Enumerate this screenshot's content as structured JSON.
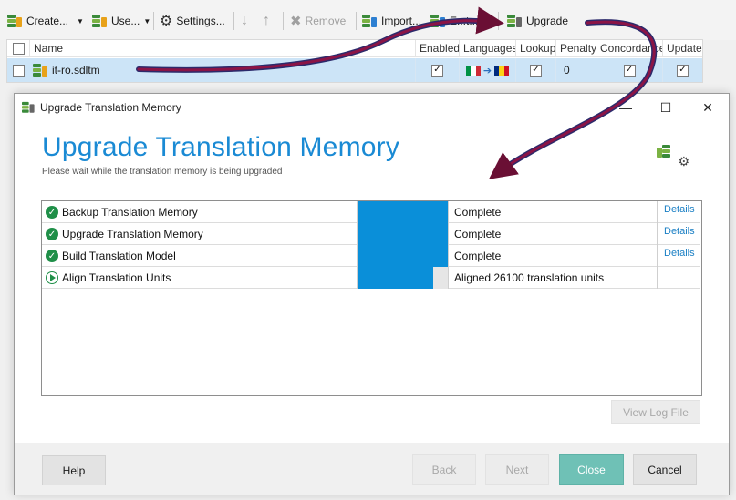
{
  "toolbar": {
    "create_label": "Create...",
    "use_label": "Use...",
    "settings_label": "Settings...",
    "remove_label": "Remove",
    "import_label": "Import...",
    "export_label": "E...t...",
    "upgrade_label": "Upgrade"
  },
  "grid": {
    "columns": [
      "Name",
      "Enabled",
      "Languages",
      "Lookup",
      "Penalty",
      "Concordance",
      "Update"
    ],
    "row": {
      "name": "it-ro.sdltm",
      "enabled": "✓",
      "lookup": "✓",
      "penalty": "0",
      "concordance": "✓",
      "update": "✓"
    },
    "source_flag_colors": [
      "#009246",
      "#ffffff",
      "#ce2b37"
    ],
    "target_flag_colors": [
      "#002b7f",
      "#fcd116",
      "#ce1126"
    ],
    "language_arrow": "➔"
  },
  "dialog": {
    "window_title": "Upgrade Translation Memory",
    "heading": "Upgrade Translation Memory",
    "subtitle": "Please wait while the translation memory is being upgraded",
    "accent_color": "#1a8ad4",
    "tasks": [
      {
        "name": "Backup Translation Memory",
        "status": "Complete",
        "progress": 1.0,
        "state": "done",
        "details": "Details"
      },
      {
        "name": "Upgrade Translation Memory",
        "status": "Complete",
        "progress": 1.0,
        "state": "done",
        "details": "Details"
      },
      {
        "name": "Build Translation Model",
        "status": "Complete",
        "progress": 1.0,
        "state": "done",
        "details": "Details"
      },
      {
        "name": "Align Translation Units",
        "status": "Aligned 26100 translation units",
        "progress": 0.84,
        "state": "running",
        "details": ""
      }
    ],
    "view_log_label": "View Log File",
    "help_label": "Help",
    "back_label": "Back",
    "next_label": "Next",
    "close_label": "Close",
    "cancel_label": "Cancel"
  }
}
